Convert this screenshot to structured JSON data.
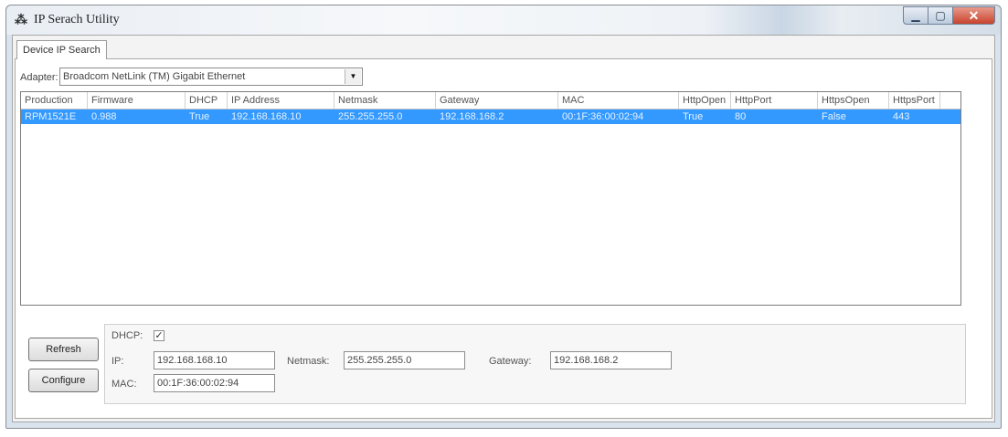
{
  "window": {
    "title": "IP Serach Utility",
    "icon": "app-logo-icon"
  },
  "tabs": [
    {
      "label": "Device IP Search"
    }
  ],
  "adapter": {
    "label": "Adapter:",
    "selected": "Broadcom NetLink (TM) Gigabit Ethernet"
  },
  "table": {
    "columns": [
      "Production",
      "Firmware",
      "DHCP",
      "IP Address",
      "Netmask",
      "Gateway",
      "MAC",
      "HttpOpen",
      "HttpPort",
      "HttpsOpen",
      "HttpsPort"
    ],
    "rows": [
      [
        "RPM1521E",
        "0.988",
        "True",
        "192.168.168.10",
        "255.255.255.0",
        "192.168.168.2",
        "00:1F:36:00:02:94",
        "True",
        "80",
        "False",
        "443"
      ]
    ]
  },
  "buttons": {
    "refresh": "Refresh",
    "configure": "Configure"
  },
  "config": {
    "dhcp_label": "DHCP:",
    "dhcp_checked": true,
    "dhcp_mark": "✓",
    "ip_label": "IP:",
    "ip_value": "192.168.168.10",
    "netmask_label": "Netmask:",
    "netmask_value": "255.255.255.0",
    "gateway_label": "Gateway:",
    "gateway_value": "192.168.168.2",
    "mac_label": "MAC:",
    "mac_value": "00:1F:36:00:02:94"
  },
  "colors": {
    "selection": "#3399ff",
    "close_button": "#c8432d"
  }
}
